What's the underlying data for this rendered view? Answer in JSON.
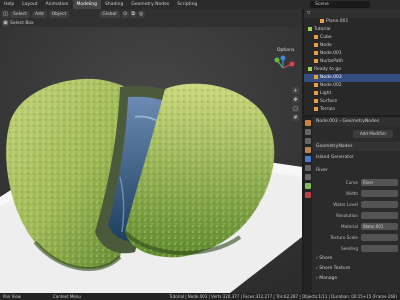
{
  "topbar": {
    "menus": [
      "Help"
    ],
    "tabs": [
      "Layout",
      "Animation",
      "Modeling",
      "Shading",
      "Geometry Nodes",
      "Scripting"
    ],
    "active_tab": "Modeling",
    "scene": "Scene"
  },
  "viewport_header": {
    "row1": [
      "Select",
      "Add",
      "Object"
    ],
    "mode": "Global",
    "row2_label": "Select Box",
    "options": "Options"
  },
  "outliner": {
    "rows": [
      {
        "label": "Plane.001",
        "indent": 2,
        "selected": false
      },
      {
        "label": "Tutorial",
        "indent": 0,
        "selected": false
      },
      {
        "label": "Cube",
        "indent": 1,
        "selected": false
      },
      {
        "label": "Node",
        "indent": 1,
        "selected": false
      },
      {
        "label": "Node.001",
        "indent": 1,
        "selected": false
      },
      {
        "label": "NurbsPath",
        "indent": 1,
        "selected": false
      },
      {
        "label": "Ready to go",
        "indent": 0,
        "selected": false
      },
      {
        "label": "Node.003",
        "indent": 1,
        "selected": true
      },
      {
        "label": "Node.002",
        "indent": 1,
        "selected": false
      },
      {
        "label": "Light",
        "indent": 1,
        "selected": false
      },
      {
        "label": "Surface",
        "indent": 1,
        "selected": false
      },
      {
        "label": "Terrain",
        "indent": 1,
        "selected": false
      }
    ]
  },
  "properties": {
    "breadcrumb": "Node.003  ›  GeometryNodes",
    "add_modifier": "Add Modifier",
    "modifier_name": "GeometryNodes",
    "node_group": "Island Generator",
    "section_river": "River",
    "fields": [
      {
        "label": "Curve",
        "value": "River"
      },
      {
        "label": "Width",
        "value": ""
      },
      {
        "label": "Water Level",
        "value": ""
      },
      {
        "label": "Resolution",
        "value": ""
      },
      {
        "label": "Material",
        "value": "Water.001"
      },
      {
        "label": "Texture Scale",
        "value": ""
      },
      {
        "label": "Seeding",
        "value": ""
      }
    ],
    "sections_bottom": [
      "Shore",
      "Shore Texture",
      "Manage"
    ]
  },
  "statusbar": {
    "left": "Pan View",
    "mid": "Context Menu",
    "right": "Tutorial | Node.003 | Verts:320,377 | Faces:312,277 | Tris:62,287 | Objects:1/11 | Duration: 00:15+15 (Frame 260)"
  },
  "colors": {
    "accent_blue": "#334d80",
    "collection_green": "#9ad45a",
    "object_orange": "#e8a040"
  }
}
